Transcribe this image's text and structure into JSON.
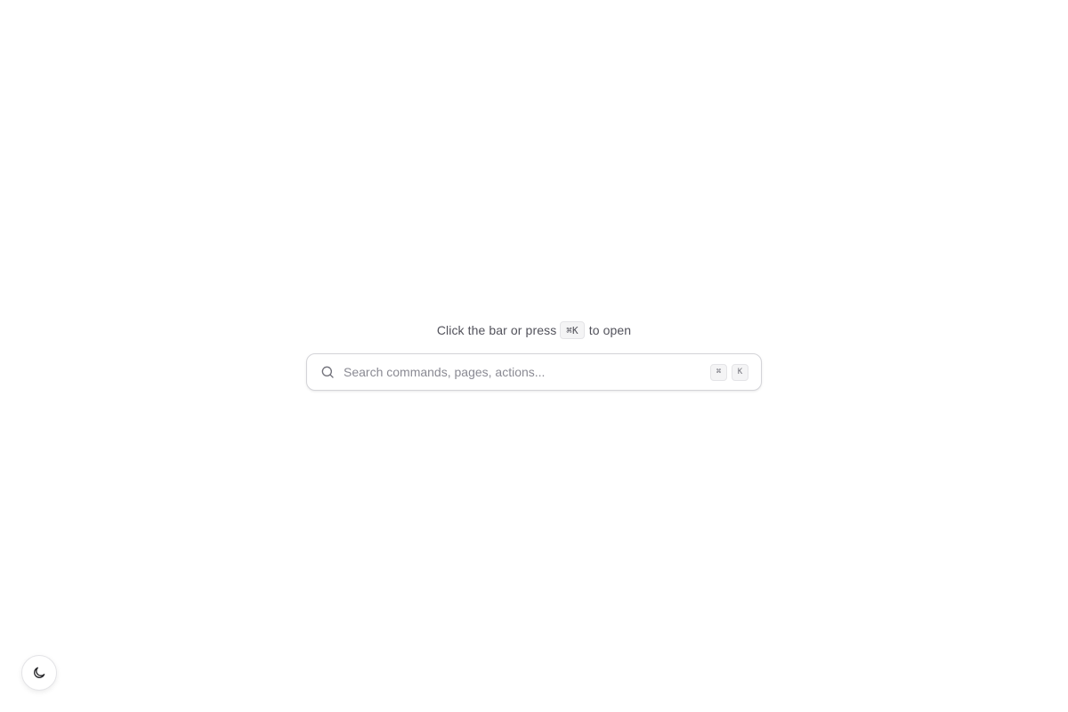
{
  "hint": {
    "prefix": "Click the bar or press",
    "shortcut": "⌘K",
    "suffix": "to open"
  },
  "search": {
    "placeholder": "Search commands, pages, actions...",
    "shortcut_keys": [
      "⌘",
      "K"
    ]
  },
  "icons": {
    "search": "search-icon",
    "theme_toggle": "moon-icon"
  },
  "colors": {
    "background": "#ffffff",
    "text_muted": "#52525b",
    "placeholder": "#8a8a93",
    "border": "#d4d4d8",
    "key_background": "#f4f4f5"
  }
}
